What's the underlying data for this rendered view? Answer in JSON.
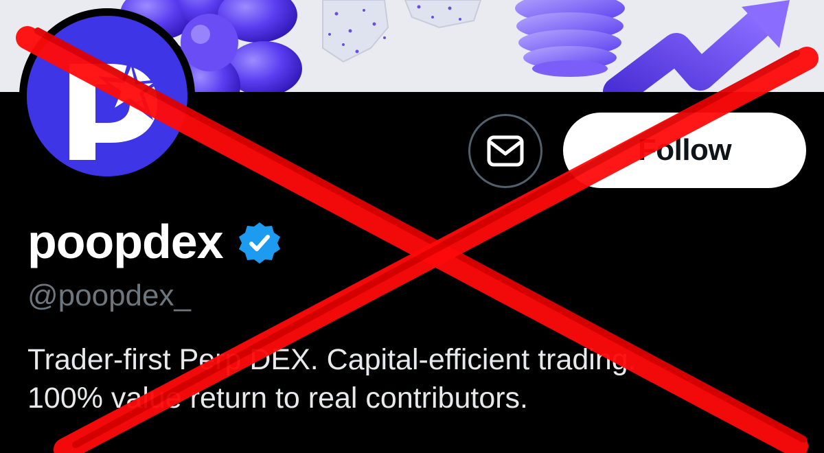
{
  "profile": {
    "display_name": "poopdex",
    "handle": "@poopdex_",
    "verified": true,
    "bio_lines": [
      "Trader-first Perp DEX. Capital-efficient trading.",
      "100% value return to real contributors."
    ]
  },
  "actions": {
    "follow_label": "Follow",
    "message_icon": "envelope-icon"
  },
  "icons": {
    "verified_badge": "verified-check-icon",
    "avatar_logo": "poopdex-logo-icon"
  },
  "colors": {
    "background": "#000000",
    "avatar_brand": "#3d35e6",
    "verified_blue": "#1d9bf0",
    "follow_button_bg": "#ffffff",
    "handle_gray": "#6e767d",
    "cross_red": "#ff0a0a",
    "banner_purple": "#5a3df0"
  }
}
